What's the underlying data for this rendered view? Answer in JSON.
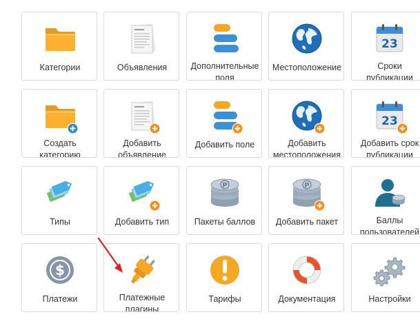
{
  "accent": "#e31e1e",
  "rows": [
    [
      {
        "name": "categories",
        "icon": "folder",
        "badge": false,
        "label": "Категории"
      },
      {
        "name": "listings",
        "icon": "document",
        "badge": false,
        "label": "Объявления"
      },
      {
        "name": "extra-fields",
        "icon": "fields",
        "badge": false,
        "label": "Дополнительные\nполя"
      },
      {
        "name": "locations",
        "icon": "globe",
        "badge": false,
        "label": "Местоположение"
      },
      {
        "name": "publish-terms",
        "icon": "calendar",
        "badge": false,
        "label": "Сроки\nпубликации"
      }
    ],
    [
      {
        "name": "create-category",
        "icon": "folder",
        "badge": true,
        "label": "Создать\nкатегорию"
      },
      {
        "name": "add-listing",
        "icon": "document",
        "badge": true,
        "label": "Добавить\nобъявление"
      },
      {
        "name": "add-field",
        "icon": "fields",
        "badge": true,
        "label": "Добавить поле"
      },
      {
        "name": "add-location",
        "icon": "globe",
        "badge": true,
        "label": "Добавить\nместоположения"
      },
      {
        "name": "add-publish-term",
        "icon": "calendar",
        "badge": true,
        "label": "Добавить срок\nпубликации"
      }
    ],
    [
      {
        "name": "types",
        "icon": "tags",
        "badge": false,
        "label": "Типы"
      },
      {
        "name": "add-type",
        "icon": "tags",
        "badge": true,
        "label": "Добавить тип"
      },
      {
        "name": "point-packages",
        "icon": "coins",
        "badge": false,
        "label": "Пакеты баллов"
      },
      {
        "name": "add-package",
        "icon": "coins",
        "badge": true,
        "label": "Добавить пакет"
      },
      {
        "name": "user-points",
        "icon": "user",
        "badge": false,
        "label": "Баллы\nпользователей"
      }
    ],
    [
      {
        "name": "payments",
        "icon": "dollar",
        "badge": false,
        "label": "Платежи"
      },
      {
        "name": "payment-plugins",
        "icon": "plug",
        "badge": false,
        "label": "Платежные\nплагины"
      },
      {
        "name": "tariffs",
        "icon": "warning",
        "badge": false,
        "label": "Тарифы"
      },
      {
        "name": "documentation",
        "icon": "lifebuoy",
        "badge": false,
        "label": "Документация"
      },
      {
        "name": "settings",
        "icon": "gears",
        "badge": false,
        "label": "Настройки"
      }
    ]
  ]
}
